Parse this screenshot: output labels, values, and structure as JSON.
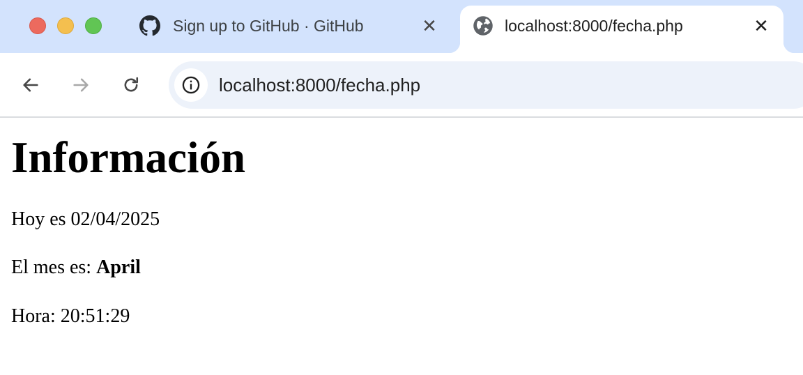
{
  "browser": {
    "tabs": [
      {
        "title": "Sign up to GitHub · GitHub",
        "icon": "github-icon",
        "active": false
      },
      {
        "title": "localhost:8000/fecha.php",
        "icon": "globe-icon",
        "active": true
      }
    ],
    "url": "localhost:8000/fecha.php",
    "close_glyph": "✕",
    "colors": {
      "tabstrip": "#d3e3fd",
      "omnibox": "#edf2fa"
    }
  },
  "page": {
    "heading": "Información",
    "date_prefix": "Hoy es ",
    "date_value": "02/04/2025",
    "month_prefix": "El mes es: ",
    "month_value": "April",
    "time_prefix": "Hora: ",
    "time_value": "20:51:29"
  }
}
